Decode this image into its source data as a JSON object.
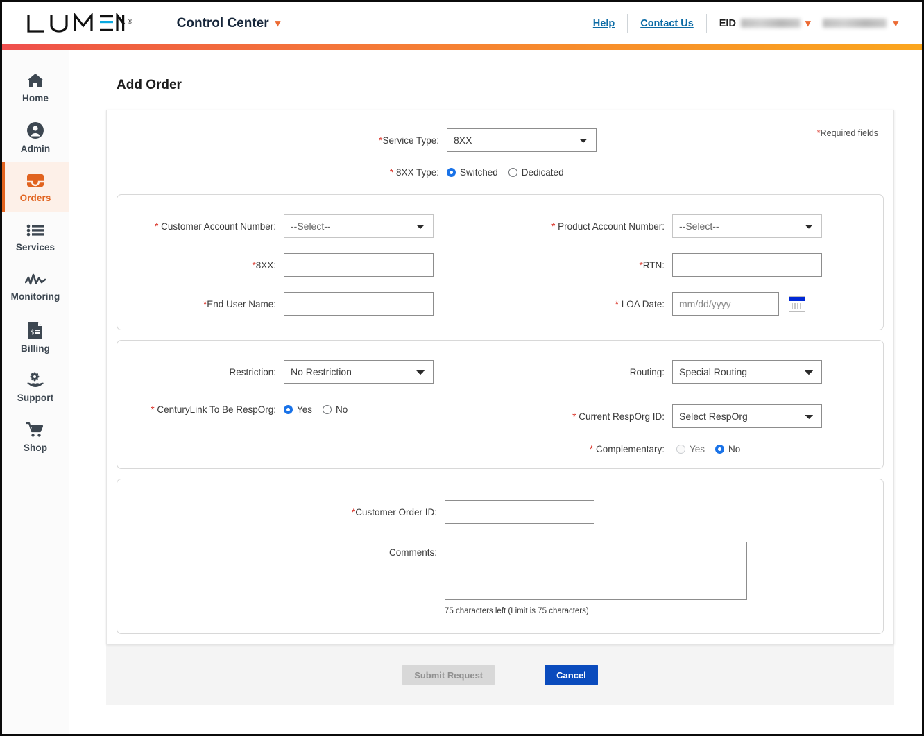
{
  "header": {
    "logo_text": "LUMEN",
    "logo_reg": "®",
    "app_title": "Control Center",
    "app_caret": "chevron-down-icon",
    "help_label": "Help",
    "contact_label": "Contact Us",
    "eid_label": "EID",
    "eid_value": "",
    "account_value": "",
    "accent_gradient_from": "#ef4e4e",
    "accent_gradient_to": "#fba61e"
  },
  "sidebar": {
    "active": "Orders",
    "active_color": "#e1631f",
    "items": [
      {
        "label": "Home",
        "icon": "home-icon"
      },
      {
        "label": "Admin",
        "icon": "user-circle-icon"
      },
      {
        "label": "Orders",
        "icon": "inbox-icon"
      },
      {
        "label": "Services",
        "icon": "list-icon"
      },
      {
        "label": "Monitoring",
        "icon": "pulse-icon"
      },
      {
        "label": "Billing",
        "icon": "invoice-icon"
      },
      {
        "label": "Support",
        "icon": "support-hand-icon"
      },
      {
        "label": "Shop",
        "icon": "cart-icon"
      }
    ]
  },
  "main": {
    "page_title": "Add Order",
    "required_note_star": "*",
    "required_note": "Required fields",
    "service": {
      "service_type_label": "Service Type:",
      "service_type_value": "8XX",
      "service_type_options": [
        "8XX"
      ],
      "type_label": "8XX Type:",
      "type_options": [
        "Switched",
        "Dedicated"
      ],
      "type_selected": "Switched"
    },
    "account_section": {
      "customer_account_label": "Customer Account Number:",
      "customer_account_value": "--Select--",
      "product_account_label": "Product Account Number:",
      "product_account_value": "--Select--",
      "eight_xx_label": "8XX:",
      "eight_xx_value": "",
      "rtn_label": "RTN:",
      "rtn_value": "",
      "end_user_label": "End User Name:",
      "end_user_value": "",
      "loa_date_label": "LOA Date:",
      "loa_date_value": "",
      "loa_date_placeholder": "mm/dd/yyyy",
      "calendar_icon": "calendar-icon"
    },
    "routing_section": {
      "restriction_label": "Restriction:",
      "restriction_value": "No Restriction",
      "routing_label": "Routing:",
      "routing_value": "Special Routing",
      "resporg_question_label": "CenturyLink To Be RespOrg:",
      "resporg_yes": "Yes",
      "resporg_no": "No",
      "resporg_selected": "Yes",
      "current_resporg_label": "Current RespOrg ID:",
      "current_resporg_value": "Select RespOrg",
      "complementary_label": "Complementary:",
      "complementary_yes": "Yes",
      "complementary_no": "No",
      "complementary_selected": "No"
    },
    "order_section": {
      "customer_order_id_label": "Customer Order ID:",
      "customer_order_id_value": "",
      "comments_label": "Comments:",
      "comments_value": "",
      "char_count": "75 characters left (Limit is 75 characters)"
    }
  },
  "footer": {
    "submit_label": "Submit Request",
    "submit_enabled": false,
    "cancel_label": "Cancel",
    "cancel_color": "#0a4bbd"
  }
}
